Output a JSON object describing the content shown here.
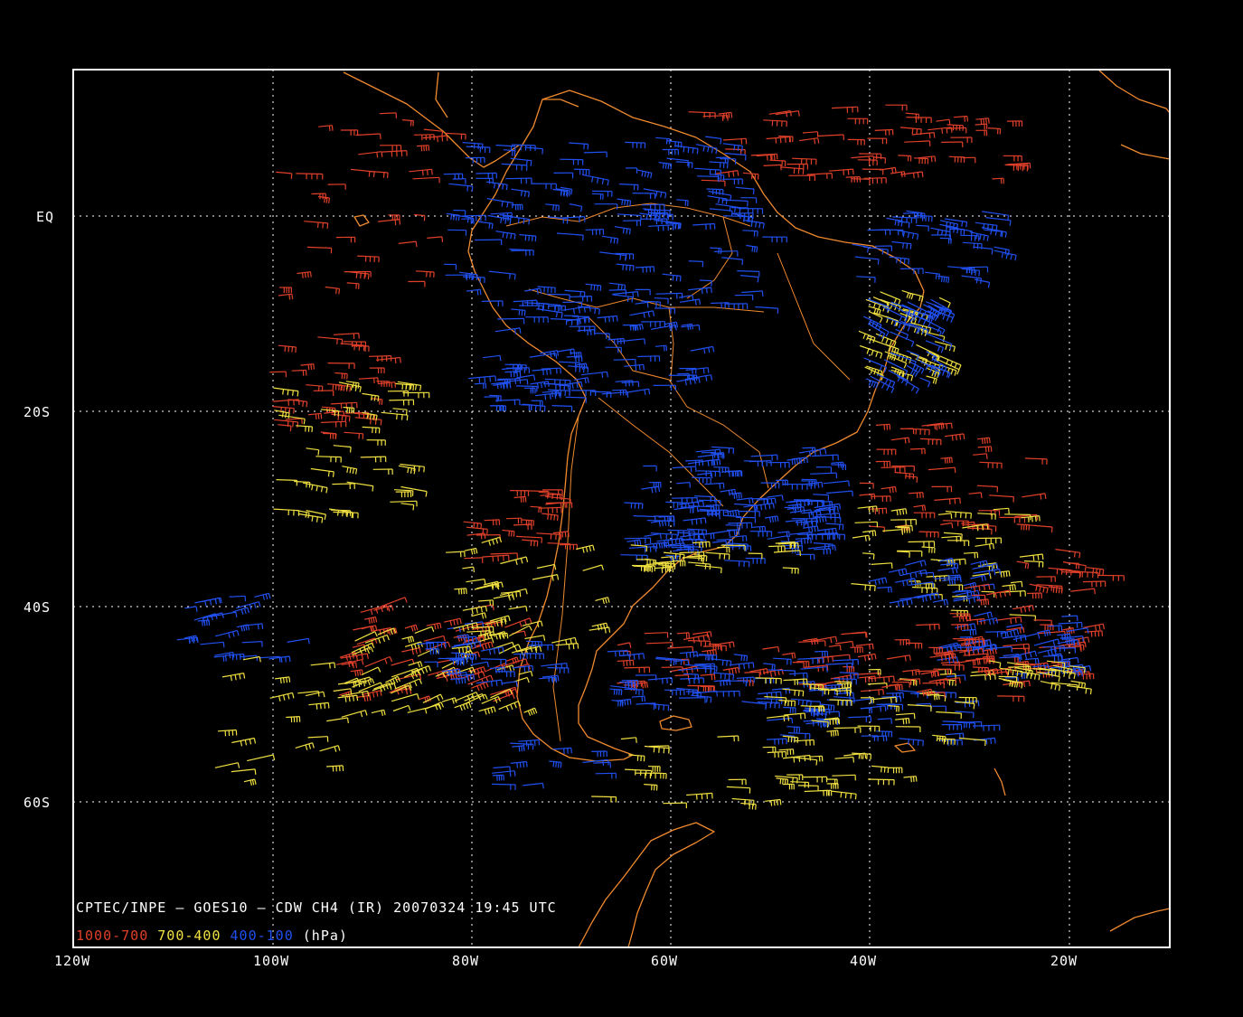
{
  "title": "CPTEC/INPE – GOES10 – CDW CH4 (IR) 20070324 19:45 UTC",
  "legend": {
    "items": [
      {
        "label": "1000-700",
        "color": "#e0402a"
      },
      {
        "label": "700-400",
        "color": "#f0e040"
      },
      {
        "label": "400-100",
        "color": "#2050f0"
      }
    ],
    "unit": "(hPa)"
  },
  "axes": {
    "x_ticks": [
      "120W",
      "100W",
      "80W",
      "60W",
      "40W",
      "20W"
    ],
    "y_ticks": [
      "EQ",
      "20S",
      "40S",
      "60S"
    ]
  },
  "colors": {
    "background": "#000000",
    "coastline": "#f08a2e",
    "low": "#e0402a",
    "mid": "#f0e040",
    "high": "#2050f0"
  },
  "bounds": {
    "lon": [
      -120,
      -10
    ],
    "lat": [
      -75,
      15
    ]
  }
}
